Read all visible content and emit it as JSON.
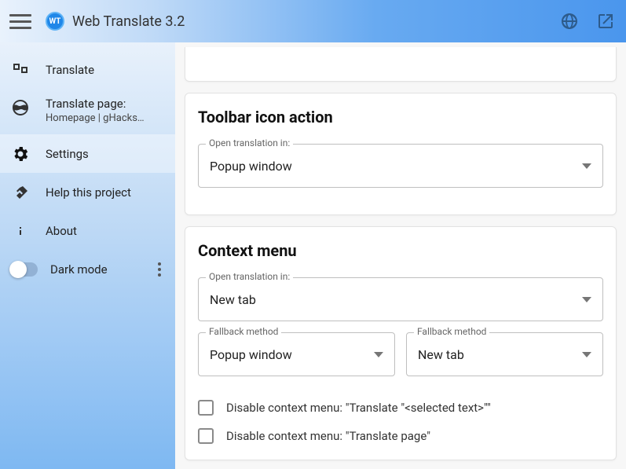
{
  "header": {
    "title": "Web Translate 3.2"
  },
  "sidebar": {
    "items": [
      {
        "label": "Translate"
      },
      {
        "label": "Translate page:",
        "sub": "Homepage | gHacks…"
      },
      {
        "label": "Settings"
      },
      {
        "label": "Help this project"
      },
      {
        "label": "About"
      },
      {
        "label": "Dark mode"
      }
    ]
  },
  "sections": {
    "toolbar": {
      "title": "Toolbar icon action",
      "field1_legend": "Open translation in:",
      "field1_value": "Popup window"
    },
    "context": {
      "title": "Context menu",
      "field1_legend": "Open translation in:",
      "field1_value": "New tab",
      "field2_legend": "Fallback method",
      "field2_value": "Popup window",
      "field3_legend": "Fallback method",
      "field3_value": "New tab",
      "cb1_label": "Disable context menu: \"Translate \"<selected text>\"\"",
      "cb2_label": "Disable context menu: \"Translate page\""
    }
  }
}
